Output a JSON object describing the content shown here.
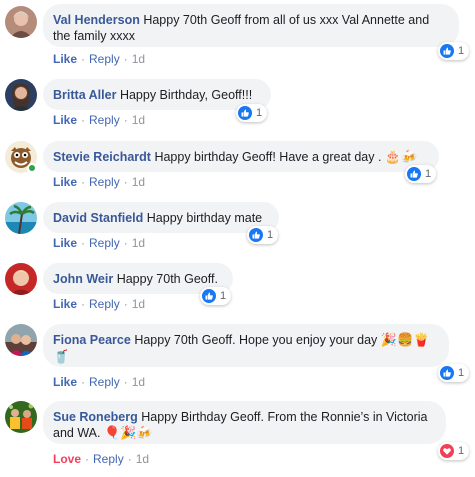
{
  "comments": [
    {
      "author": "Val Henderson",
      "text": "Happy 70th Geoff from all of us xxx Val Annette and the family xxxx",
      "emoji": "",
      "action": "Like",
      "reply": "Reply",
      "time": "1d",
      "reaction_type": "like-icon",
      "reaction_count": "1"
    },
    {
      "author": "Britta Aller",
      "text": "Happy Birthday, Geoff!!!",
      "emoji": "",
      "action": "Like",
      "reply": "Reply",
      "time": "1d",
      "reaction_type": "like-icon",
      "reaction_count": "1"
    },
    {
      "author": "Stevie Reichardt",
      "text": "Happy birthday Geoff! Have a great day .",
      "emoji": "🎂🍻",
      "action": "Like",
      "reply": "Reply",
      "time": "1d",
      "reaction_type": "like-icon",
      "reaction_count": "1"
    },
    {
      "author": "David Stanfield",
      "text": "Happy birthday mate",
      "emoji": "",
      "action": "Like",
      "reply": "Reply",
      "time": "1d",
      "reaction_type": "like-icon",
      "reaction_count": "1"
    },
    {
      "author": "John Weir",
      "text": "Happy 70th Geoff.",
      "emoji": "",
      "action": "Like",
      "reply": "Reply",
      "time": "1d",
      "reaction_type": "like-icon",
      "reaction_count": "1"
    },
    {
      "author": "Fiona Pearce",
      "text": "Happy 70th Geoff. Hope you enjoy your day",
      "emoji": "🎉🍔🍟🥤",
      "action": "Like",
      "reply": "Reply",
      "time": "1d",
      "reaction_type": "like-icon",
      "reaction_count": "1"
    },
    {
      "author": "Sue Roneberg",
      "text": "Happy Birthday Geoff. From the Ronnie’s in Victoria and WA.",
      "emoji": "🎈🎉🍻",
      "action": "Love",
      "reply": "Reply",
      "time": "1d",
      "reaction_type": "love-icon",
      "reaction_count": "1"
    }
  ],
  "colors": {
    "author": "#385898",
    "link": "#4267b2",
    "love": "#f33e58",
    "bubble": "#f2f3f5",
    "like_badge": "#1877f2",
    "online": "#31a24c"
  }
}
